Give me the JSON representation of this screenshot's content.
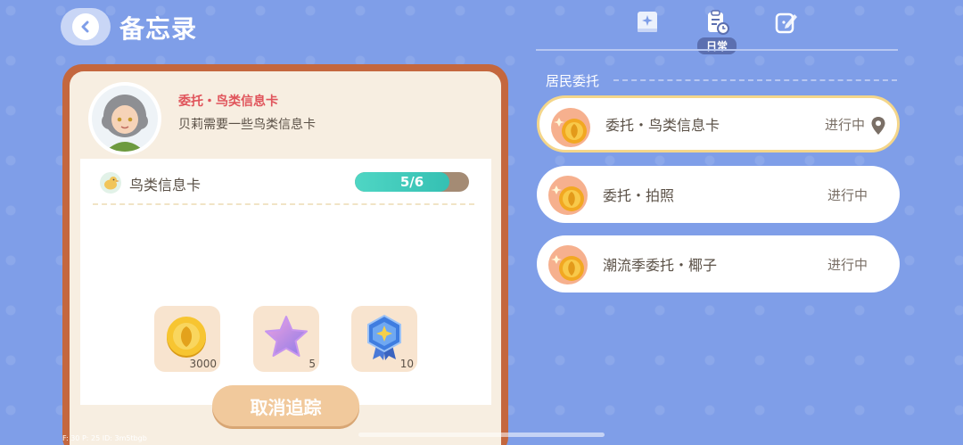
{
  "header": {
    "title": "备忘录"
  },
  "tabs": [
    {
      "name": "tab-handbook",
      "label": ""
    },
    {
      "name": "tab-daily",
      "label": "日常"
    },
    {
      "name": "tab-edit",
      "label": ""
    }
  ],
  "quest": {
    "title": "委托・鸟类信息卡",
    "description": "贝莉需要一些鸟类信息卡",
    "objective": "鸟类信息卡",
    "progress_text": "5/6",
    "progress": 0.83,
    "rewards": [
      {
        "icon": "gold-coin-icon",
        "count": "3000"
      },
      {
        "icon": "purple-star-icon",
        "count": "5"
      },
      {
        "icon": "blue-badge-icon",
        "count": "10"
      }
    ],
    "cancel_label": "取消追踪"
  },
  "tasks_section": {
    "title": "居民委托",
    "items": [
      {
        "name": "委托・鸟类信息卡",
        "status": "进行中",
        "selected": true
      },
      {
        "name": "委托・拍照",
        "status": "进行中",
        "selected": false
      },
      {
        "name": "潮流季委托・椰子",
        "status": "进行中",
        "selected": false
      }
    ]
  },
  "debug_text": "F: 30   P: 25   ID: 3m5tbgb"
}
